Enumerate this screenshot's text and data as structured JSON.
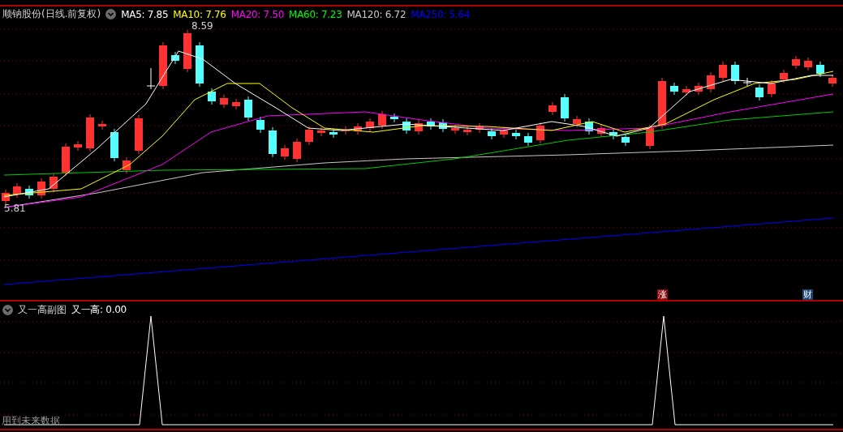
{
  "main_chart": {
    "title": "顺钠股份(日线.前复权)",
    "indicators": [
      {
        "label": "MA5: 7.85",
        "color": "#ffffff"
      },
      {
        "label": "MA10: 7.76",
        "color": "#ffff00"
      },
      {
        "label": "MA20: 7.50",
        "color": "#ff00ff"
      },
      {
        "label": "MA60: 7.23",
        "color": "#00ff00"
      },
      {
        "label": "MA120: 6.72",
        "color": "#c8c8c8"
      },
      {
        "label": "MA250: 5.64",
        "color": "#0000ff"
      }
    ],
    "high_label": "8.59",
    "low_label": "5.81",
    "markers": [
      {
        "text": "涨",
        "color": "#8b0a0a"
      },
      {
        "text": "财",
        "color": "#1b4a78"
      }
    ]
  },
  "sub_chart": {
    "title": "又一高副图",
    "reading": "又一高: 0.00",
    "note": "用到未来数据"
  }
}
